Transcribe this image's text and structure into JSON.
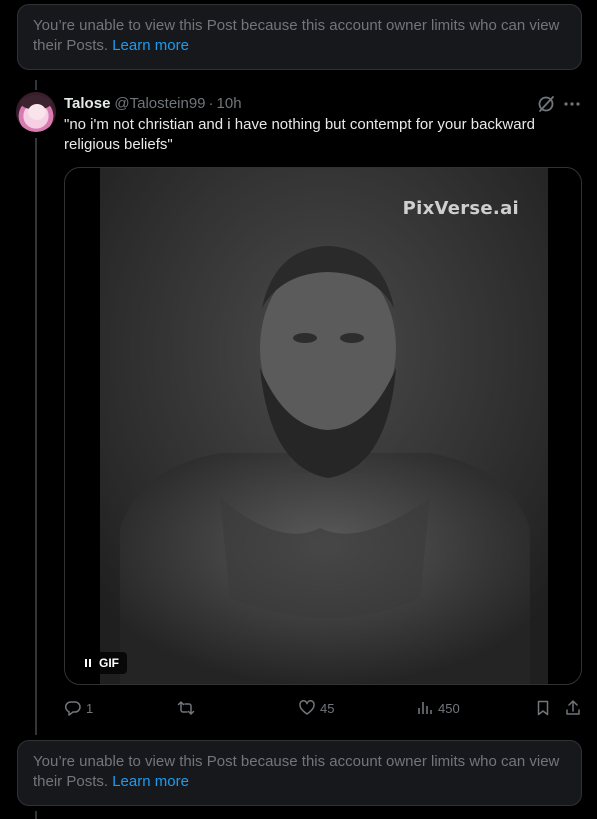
{
  "notices": {
    "top": {
      "text": "You’re unable to view this Post because this account owner limits who can view their Posts.",
      "link": "Learn more"
    },
    "bottom": {
      "text": "You’re unable to view this Post because this account owner limits who can view their Posts.",
      "link": "Learn more"
    }
  },
  "tweet": {
    "author_name": "Talose",
    "handle": "@Talostein99",
    "separator": "·",
    "time": "10h",
    "text": "\"no i'm not christian and i have nothing but contempt for your backward religious beliefs\"",
    "media": {
      "watermark": "PixVerse.ai",
      "badge_label": "GIF"
    },
    "actions": {
      "replies": "1",
      "reposts": "",
      "likes": "45",
      "views": "450"
    }
  },
  "icons": {
    "avatar": "avatar-image",
    "grok": "grok-icon",
    "more": "more-icon",
    "reply": "reply-icon",
    "repost": "repost-icon",
    "like": "heart-icon",
    "views": "views-icon",
    "bookmark": "bookmark-icon",
    "share": "share-icon",
    "pause": "pause-icon"
  },
  "colors": {
    "background": "#000000",
    "notice_bg": "#16181c",
    "border": "#2f3336",
    "muted": "#71767b",
    "text": "#e7e9ea",
    "link": "#1d9bf0"
  }
}
